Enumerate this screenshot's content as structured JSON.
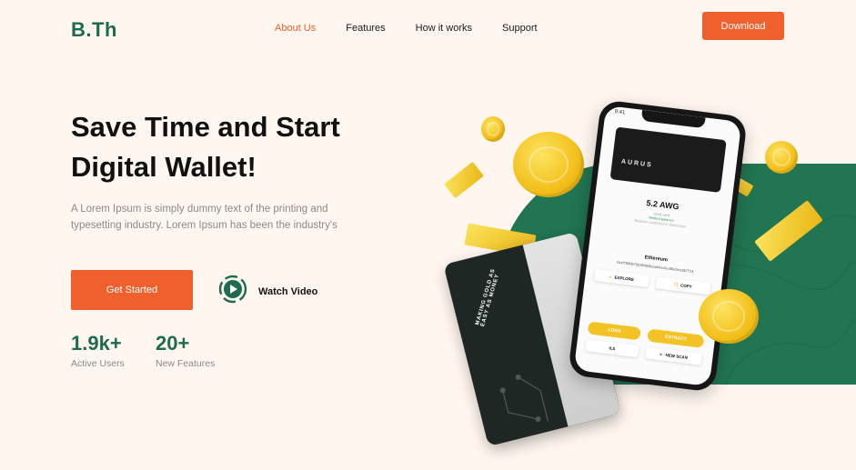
{
  "brand": {
    "logo": "B.Th"
  },
  "nav": {
    "items": [
      "About Us",
      "Features",
      "How it works",
      "Support"
    ],
    "active": "About Us"
  },
  "header": {
    "download_label": "Download"
  },
  "hero": {
    "title": "Save Time and Start Digital Wallet!",
    "description": "A Lorem Ipsum is simply dummy text of the printing and typesetting industry. Lorem Ipsum has been the industry's",
    "cta_label": "Get Started",
    "watch_label": "Watch Video"
  },
  "stats": [
    {
      "value": "1.9k+",
      "label": "Active Users"
    },
    {
      "value": "20+",
      "label": "New Features"
    }
  ],
  "phone": {
    "time": "9:41",
    "card_brand": "AURUS",
    "amount": "5.2 AWG",
    "amount_sub": "used card",
    "verified": "Verified balance",
    "balance_note": "Balance confirmed in blockchain",
    "eth_title": "Ethereum",
    "eth_address": "0x4f7f0f0b7b0384d0bead4ec6cc80e5ea182723",
    "explore_label": "EXPLORE",
    "copy_label": "COPY",
    "load_label": "LOAD",
    "extract_label": "EXTRACT",
    "details_label": "ILS",
    "scan_label": "NEW SCAN"
  },
  "card": {
    "slogan": "MAKING GOLD AS EASY AS MONEY"
  },
  "colors": {
    "accent": "#f0602c",
    "brand_green": "#1f6b4f",
    "background": "#fff7ef",
    "gold": "#f3c325"
  }
}
